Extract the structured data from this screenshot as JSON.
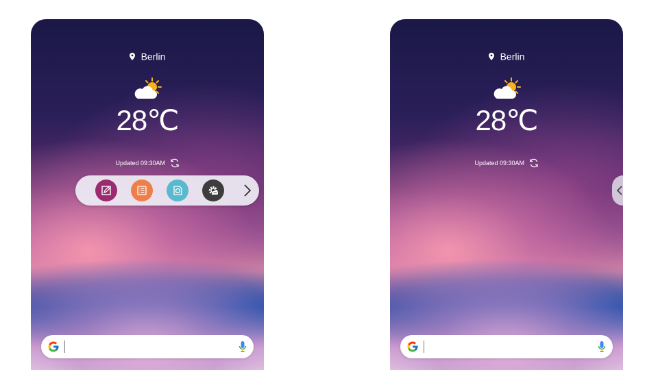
{
  "screens": [
    {
      "id": "left",
      "location": "Berlin",
      "temperature": "28℃",
      "updated": "Updated 09:30AM",
      "weather_icon": "partly-sunny-icon",
      "dock": {
        "visible": true,
        "apps": [
          {
            "name": "edit-app",
            "icon": "pencil-square-icon",
            "color": "#9b2b6f"
          },
          {
            "name": "list-app",
            "icon": "list-icon",
            "color": "#ef7f4a"
          },
          {
            "name": "camera-app",
            "icon": "camera-icon",
            "color": "#58b9cf"
          },
          {
            "name": "settings-app",
            "icon": "gear-icon",
            "color": "#3d3d3d"
          }
        ],
        "next_icon": "chevron-right-icon"
      }
    },
    {
      "id": "right",
      "location": "Berlin",
      "temperature": "28℃",
      "updated": "Updated 09:30AM",
      "weather_icon": "partly-sunny-icon",
      "edge_handle_icon": "chevron-left-icon"
    }
  ],
  "search": {
    "logo_icon": "google-icon",
    "mic_icon": "microphone-icon",
    "placeholder": ""
  }
}
